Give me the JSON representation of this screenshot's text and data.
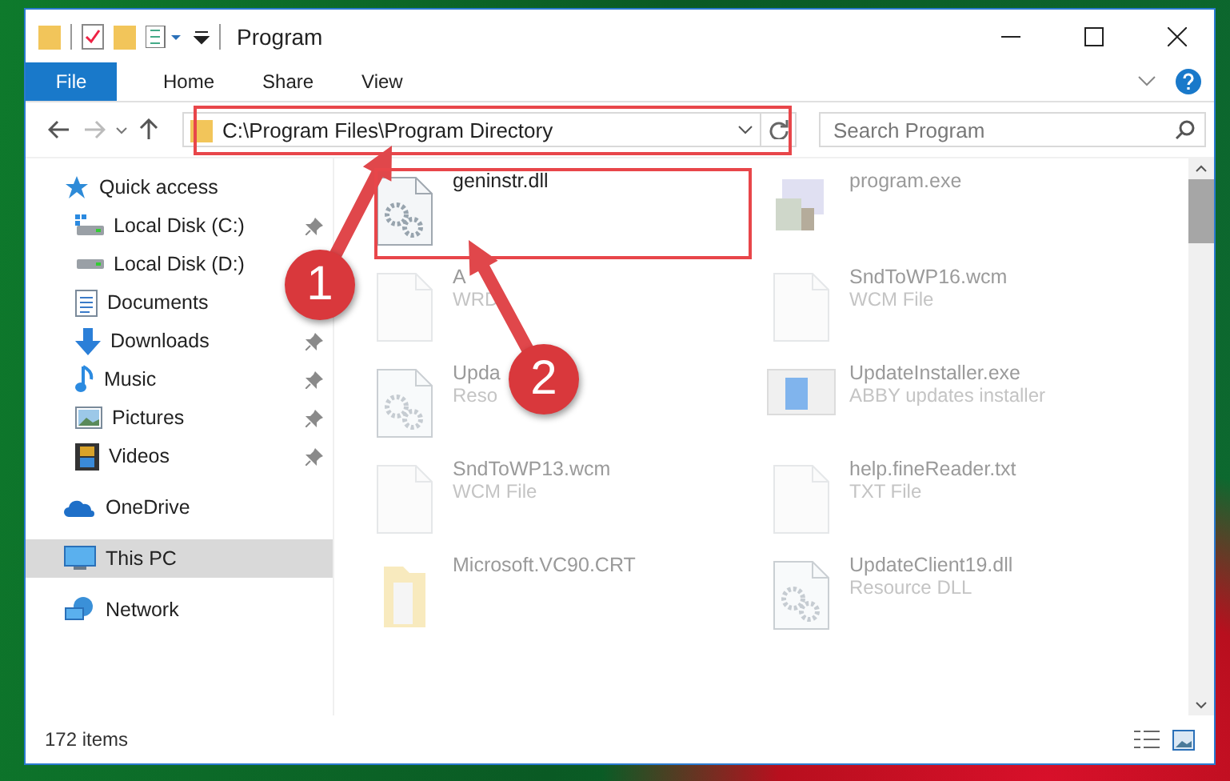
{
  "window": {
    "title": "Program"
  },
  "ribbon": {
    "file_button": "File",
    "tabs": [
      {
        "label": "Home",
        "selected": false
      },
      {
        "label": "Share",
        "selected": false
      },
      {
        "label": "View",
        "selected": false
      }
    ]
  },
  "address_bar": {
    "path": "C:\\Program Files\\Program Directory",
    "search": {
      "placeholder": "Search Program"
    }
  },
  "navigation": [
    {
      "label": "Quick access",
      "kind": "star",
      "selected": false,
      "pinned": false,
      "children": [
        {
          "label": "Local Disk (C:)",
          "kind": "drive-win",
          "selected": false,
          "pinned": true
        },
        {
          "label": "Local Disk (D:)",
          "kind": "drive",
          "selected": false,
          "pinned": false
        },
        {
          "label": "Documents",
          "kind": "docs",
          "selected": false,
          "pinned": false
        },
        {
          "label": "Downloads",
          "kind": "download",
          "selected": false,
          "pinned": true
        },
        {
          "label": "Music",
          "kind": "music",
          "selected": false,
          "pinned": true
        },
        {
          "label": "Pictures",
          "kind": "pictures",
          "selected": false,
          "pinned": true
        },
        {
          "label": "Videos",
          "kind": "videos",
          "selected": false,
          "pinned": true
        }
      ]
    },
    {
      "label": "OneDrive",
      "kind": "cloud",
      "selected": false,
      "pinned": false
    },
    {
      "label": "This PC",
      "kind": "pc",
      "selected": true,
      "pinned": false
    },
    {
      "label": "Network",
      "kind": "network",
      "selected": false,
      "pinned": false
    }
  ],
  "files": [
    {
      "name": "geninstr.dll",
      "kind": "dll",
      "focus": true
    },
    {
      "name": "program.exe",
      "kind": "exe",
      "focus": false
    },
    {
      "name": "A",
      "type": "WRD",
      "kind": "doc",
      "focus": false
    },
    {
      "name": "SndToWP16.wcm",
      "type": "WCM File",
      "kind": "doc",
      "focus": false
    },
    {
      "name": "Upda",
      "type": "Reso",
      "kind": "dll",
      "focus": false
    },
    {
      "name": "UpdateInstaller.exe",
      "type": "ABBY updates installer",
      "kind": "installer",
      "focus": false
    },
    {
      "name": "SndToWP13.wcm",
      "type": "WCM File",
      "kind": "doc",
      "focus": false
    },
    {
      "name": "help.fineReader.txt",
      "type": "TXT File",
      "kind": "doc",
      "focus": false
    },
    {
      "name": "Microsoft.VC90.CRT",
      "kind": "folder",
      "focus": false
    },
    {
      "name": "UpdateClient19.dll",
      "type": "Resource DLL",
      "kind": "dll",
      "focus": false
    }
  ],
  "status_bar": {
    "item_count": "172 items"
  },
  "callouts": [
    {
      "number": "1"
    },
    {
      "number": "2"
    }
  ]
}
